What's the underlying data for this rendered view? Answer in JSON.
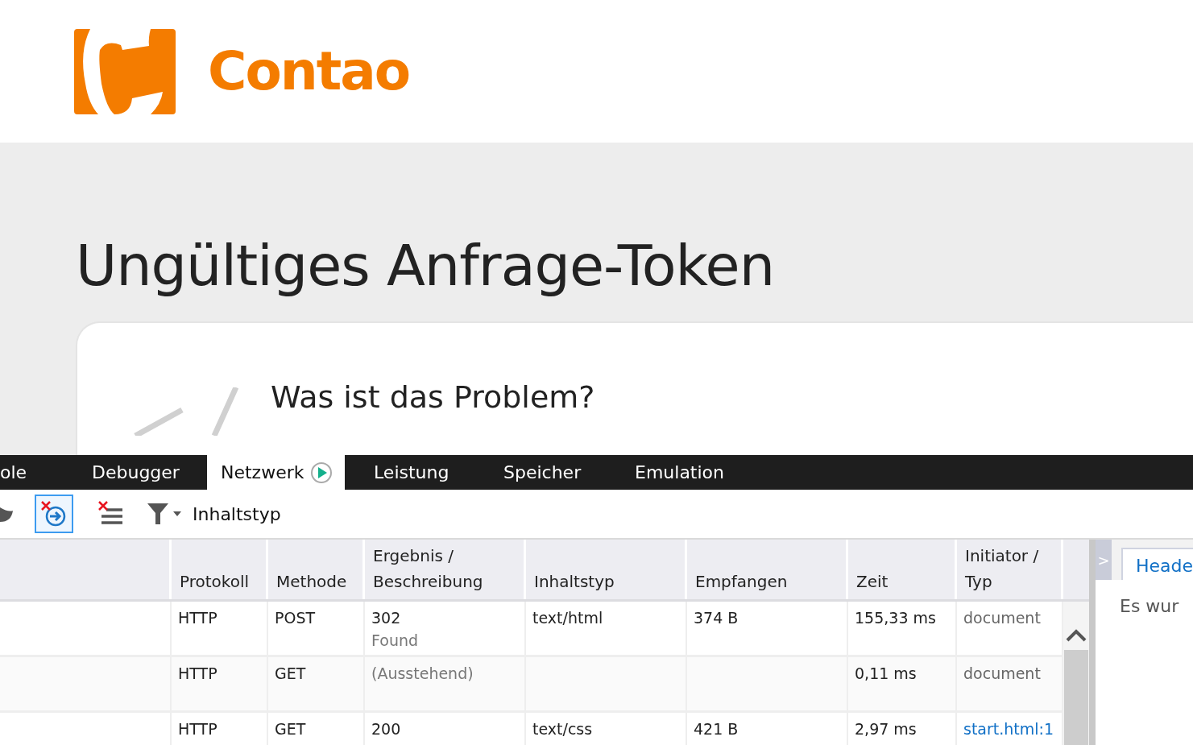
{
  "logo": {
    "text": "Contao"
  },
  "heading": "Ungültiges Anfrage-Token",
  "card": {
    "title": "Was ist das Problem?"
  },
  "devtools": {
    "tabs": [
      {
        "label": "ole",
        "selected": false
      },
      {
        "label": "Debugger",
        "selected": false
      },
      {
        "label": "Netzwerk",
        "selected": true
      },
      {
        "label": "Leistung",
        "selected": false
      },
      {
        "label": "Speicher",
        "selected": false
      },
      {
        "label": "Emulation",
        "selected": false
      }
    ],
    "toolbar": {
      "clear_on_navigate": {
        "on": true
      },
      "filter_label": "Inhaltstyp"
    },
    "table": {
      "columns": [
        "",
        "Protokoll",
        "Methode",
        "Ergebnis / Beschreibung",
        "Inhaltstyp",
        "Empfangen",
        "Zeit",
        "Initiator / Typ"
      ],
      "rows": [
        {
          "protocol": "HTTP",
          "method": "POST",
          "result": "302",
          "description": "Found",
          "pending": false,
          "content_type": "text/html",
          "received": "374 B",
          "time": "155,33 ms",
          "initiator": "document",
          "initiator_link": false
        },
        {
          "protocol": "HTTP",
          "method": "GET",
          "result": "(Ausstehend)",
          "pending": true,
          "content_type": "",
          "received": "",
          "time": "0,11 ms",
          "initiator": "document",
          "initiator_link": false
        },
        {
          "protocol": "HTTP",
          "method": "GET",
          "result": "200",
          "pending": false,
          "content_type": "text/css",
          "received": "421 B",
          "time": "2,97 ms",
          "initiator": "start.html:1",
          "initiator_link": true
        }
      ]
    },
    "side_panel": {
      "toggle": ">",
      "tab": "Heade",
      "text": "Es wur"
    }
  }
}
